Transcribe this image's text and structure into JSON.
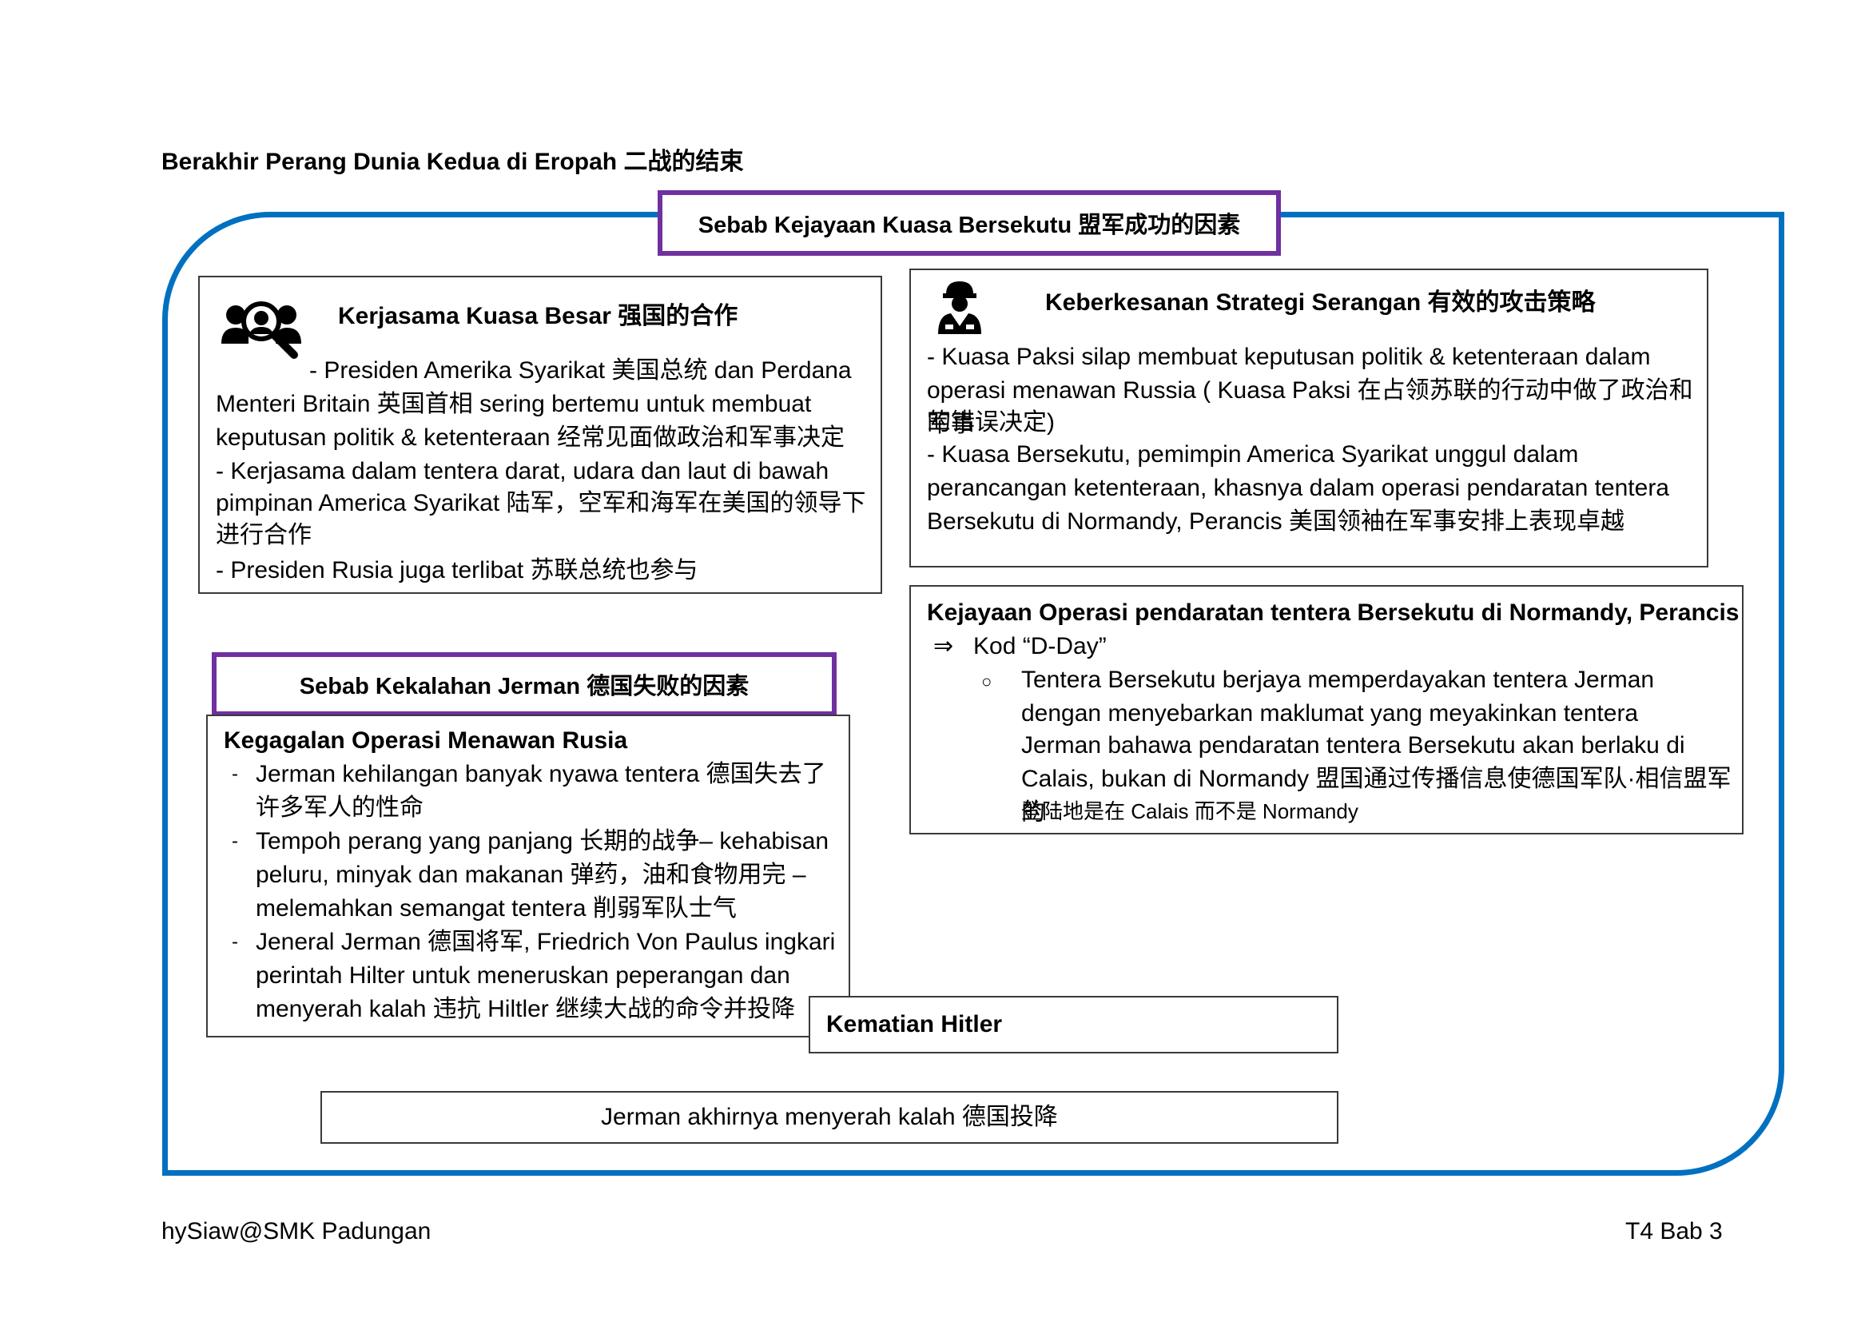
{
  "title": "Berakhir Perang Dunia Kedua di Eropah 二战的结束",
  "success_header": "Sebab Kejayaan Kuasa Bersekutu 盟军成功的因素",
  "cooperation": {
    "icon": "people-search-icon",
    "heading": "Kerjasama Kuasa Besar 强国的合作",
    "lines": [
      "- Presiden Amerika Syarikat 美国总统 dan Perdana",
      "Menteri Britain 英国首相 sering bertemu untuk membuat",
      "keputusan politik & ketenteraan 经常见面做政治和军事决定",
      "- Kerjasama dalam tentera darat, udara dan laut di bawah",
      "pimpinan America Syarikat 陆军，空军和海军在美国的领导下",
      "进行合作",
      "- Presiden Rusia juga terlibat 苏联总统也参与"
    ]
  },
  "strategy": {
    "icon": "soldier-icon",
    "heading": "Keberkesanan Strategi Serangan 有效的攻击策略",
    "lines": [
      "- Kuasa Paksi silap membuat keputusan politik & ketenteraan dalam",
      "operasi menawan Russia ( Kuasa Paksi 在占领苏联的行动中做了政治和军事",
      "的错误决定)",
      "- Kuasa Bersekutu, pemimpin America Syarikat unggul dalam",
      "perancangan ketenteraan, khasnya dalam operasi pendaratan tentera",
      "Bersekutu di Normandy, Perancis 美国领袖在军事安排上表现卓越"
    ]
  },
  "normandy": {
    "heading": "Kejayaan Operasi pendaratan tentera Bersekutu di Normandy, Perancis",
    "arrow": "⇒",
    "code": "Kod “D-Day”",
    "bullet": "○",
    "lines": [
      "Tentera Bersekutu berjaya memperdayakan tentera Jerman",
      "dengan menyebarkan maklumat yang meyakinkan tentera",
      "Jerman bahawa pendaratan tentera Bersekutu akan berlaku di",
      "Calais, bukan di Normandy 盟国通过传播信息使德国军队·相信盟军的",
      "登陆地是在 Calais 而不是 Normandy"
    ]
  },
  "defeat_header": "Sebab Kekalahan Jerman 德国失败的因素",
  "russia_failure": {
    "heading": "Kegagalan Operasi Menawan Rusia",
    "items": [
      [
        "Jerman kehilangan banyak nyawa tentera 德国失去了",
        "许多军人的性命"
      ],
      [
        "Tempoh perang yang panjang 长期的战争– kehabisan",
        "peluru, minyak dan makanan 弹药，油和食物用完 –",
        "melemahkan semangat tentera 削弱军队士气"
      ],
      [
        "Jeneral Jerman 德国将军, Friedrich Von Paulus ingkari",
        "perintah Hilter untuk meneruskan peperangan dan",
        "menyerah kalah 违抗 Hiltler 继续大战的命令并投降"
      ]
    ]
  },
  "hitler_death": "Kematian Hitler",
  "conclusion": "Jerman akhirnya menyerah kalah 德国投降",
  "footer": {
    "left": "hySiaw@SMK Padungan",
    "right": "T4 Bab 3"
  },
  "colors": {
    "outer_border": "#0070c0",
    "header_border": "#7030a0"
  }
}
